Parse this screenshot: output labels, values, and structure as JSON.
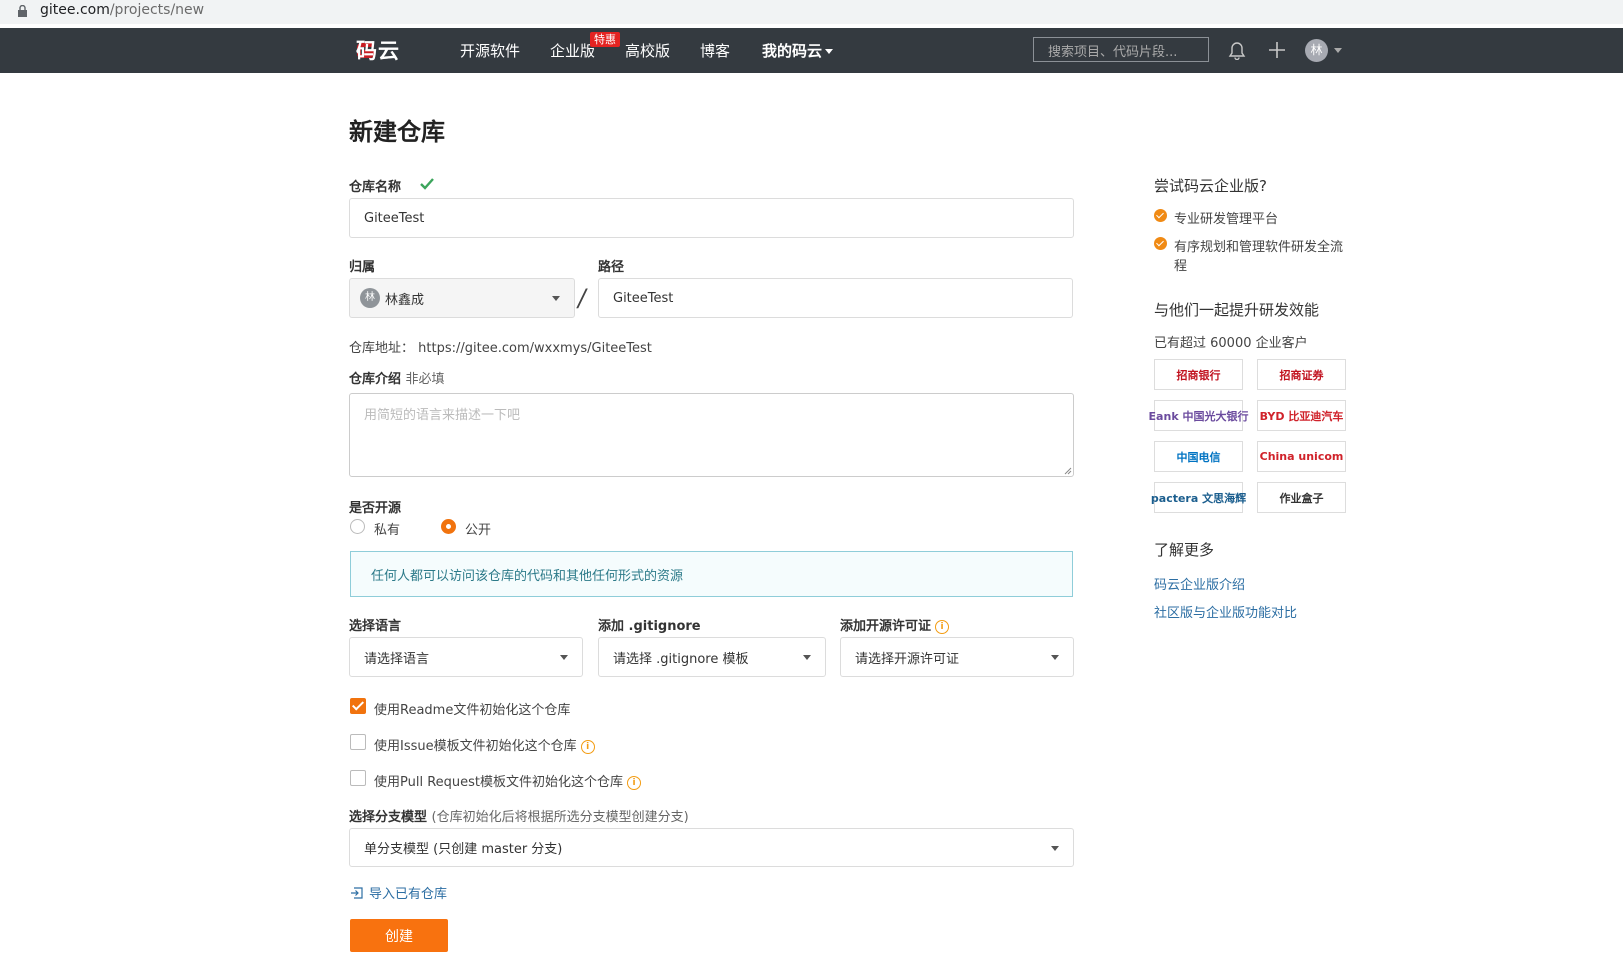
{
  "browser": {
    "url_host": "gitee.com",
    "url_path": "/projects/new"
  },
  "nav": {
    "logo": "码云",
    "items": [
      "开源软件",
      "企业版",
      "高校版",
      "博客",
      "我的码云"
    ],
    "hot_badge": "特惠",
    "search_placeholder": "搜索项目、代码片段...",
    "avatar": "林"
  },
  "form": {
    "title": "新建仓库",
    "name_label": "仓库名称",
    "name_value": "GiteeTest",
    "owner_label": "归属",
    "owner_avatar": "林",
    "owner_value": "林鑫成",
    "path_label": "路径",
    "path_value": "GiteeTest",
    "address_label": "仓库地址：",
    "address_value": "https://gitee.com/wxxmys/GiteeTest",
    "desc_label": "仓库介绍",
    "desc_optional": "非必填",
    "desc_placeholder": "用简短的语言来描述一下吧",
    "visibility_label": "是否开源",
    "visibility_options": [
      "私有",
      "公开"
    ],
    "visibility_selected": "公开",
    "visibility_hint": "任何人都可以访问该仓库的代码和其他任何形式的资源",
    "language_label": "选择语言",
    "language_value": "请选择语言",
    "gitignore_label": "添加 .gitignore",
    "gitignore_value": "请选择 .gitignore 模板",
    "license_label": "添加开源许可证",
    "license_value": "请选择开源许可证",
    "checkboxes": [
      {
        "label": "使用Readme文件初始化这个仓库",
        "checked": true
      },
      {
        "label": "使用Issue模板文件初始化这个仓库",
        "checked": false
      },
      {
        "label": "使用Pull Request模板文件初始化这个仓库",
        "checked": false
      }
    ],
    "branch_label": "选择分支模型",
    "branch_note": "(仓库初始化后将根据所选分支模型创建分支)",
    "branch_value": "单分支模型 (只创建 master 分支)",
    "import_link": "导入已有仓库",
    "create_button": "创建"
  },
  "sidebar": {
    "enterprise_title": "尝试码云企业版?",
    "features": [
      "专业研发管理平台",
      "有序规划和管理软件研发全流程"
    ],
    "together_title": "与他们一起提升研发效能",
    "customers_text": "已有超过 60000 企业客户",
    "logos": [
      "招商银行",
      "招商证券",
      "Eank 中国光大银行",
      "BYD 比亚迪汽车",
      "中国电信",
      "China unicom",
      "pactera 文思海辉",
      "作业盒子"
    ],
    "learn_more_title": "了解更多",
    "links": [
      "码云企业版介绍",
      "社区版与企业版功能对比"
    ]
  },
  "colors": {
    "accent": "#f1730e",
    "nav_bg": "#343a40",
    "link": "#2c6ea3"
  }
}
